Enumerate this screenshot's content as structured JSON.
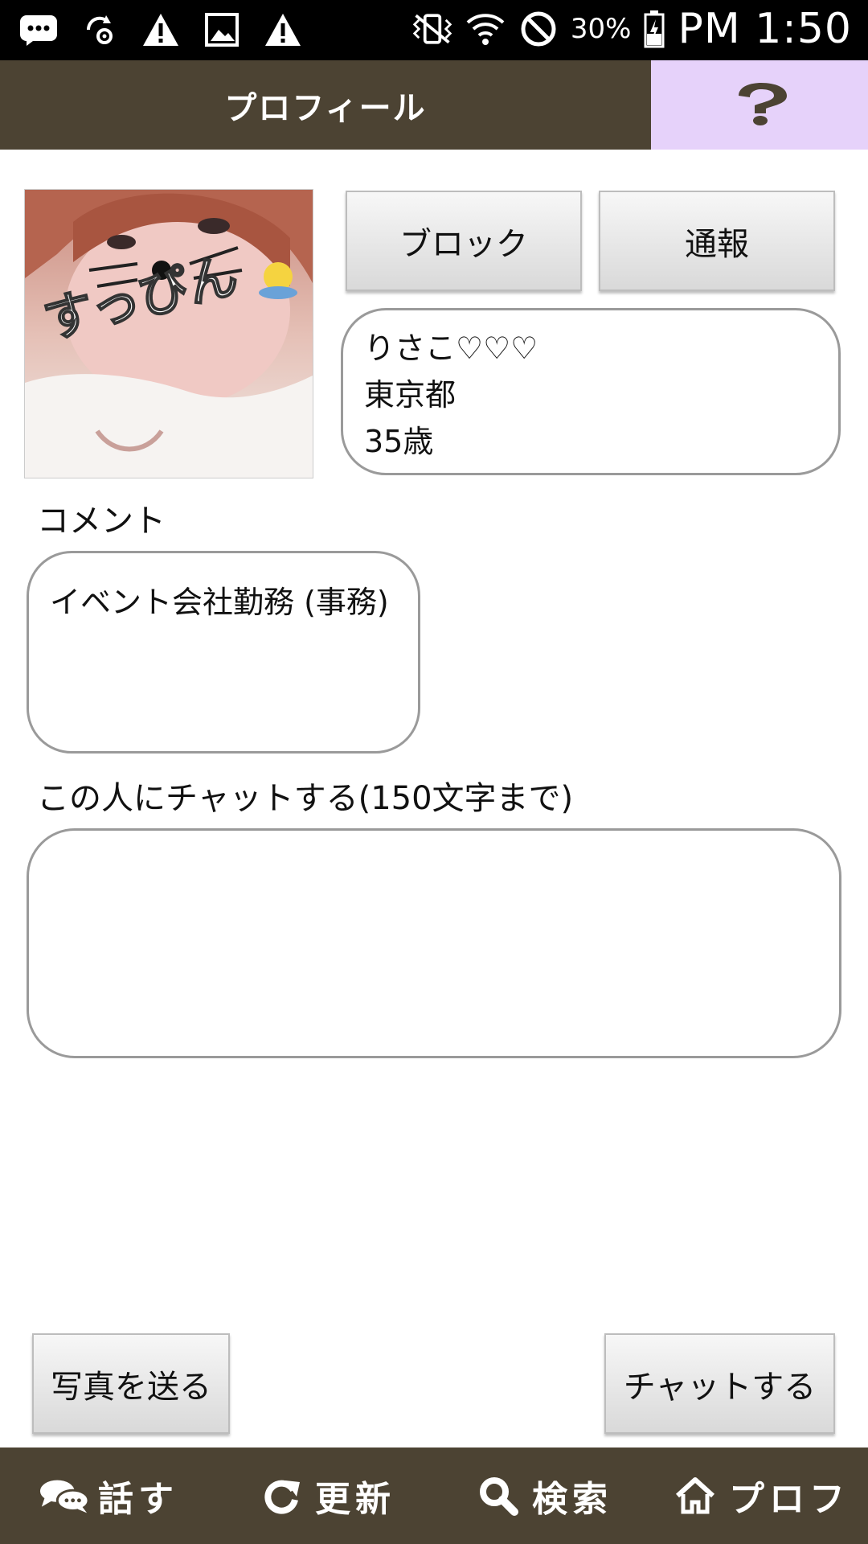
{
  "status_bar": {
    "battery_percent": "30%",
    "time": "PM 1:50",
    "icons": [
      "messages-icon",
      "sync-settings-icon",
      "warning-icon",
      "image-icon",
      "warning-icon",
      "vibrate-icon",
      "wifi-icon",
      "do-not-disturb-icon",
      "battery-icon"
    ]
  },
  "header": {
    "title": "プロフィール",
    "help_icon": "question-mark-icon",
    "help_color": "#e6d2fa",
    "bar_color": "#4c4333"
  },
  "profile": {
    "photo_caption": "すっぴん",
    "name": "りさこ♡♡♡",
    "location": "東京都",
    "age": "35歳"
  },
  "actions": {
    "block_label": "ブロック",
    "report_label": "通報"
  },
  "comment": {
    "label": "コメント",
    "text": "イベント会社勤務 (事務)"
  },
  "chat": {
    "label": "この人にチャットする(150文字まで)",
    "value": "",
    "send_photo_label": "写真を送る",
    "send_chat_label": "チャットする"
  },
  "bottom_nav": {
    "items": [
      {
        "label": "話す",
        "icon": "chat-bubbles-icon"
      },
      {
        "label": "更新",
        "icon": "refresh-icon"
      },
      {
        "label": "検索",
        "icon": "search-icon"
      },
      {
        "label": "プロフ",
        "icon": "home-icon"
      }
    ]
  }
}
